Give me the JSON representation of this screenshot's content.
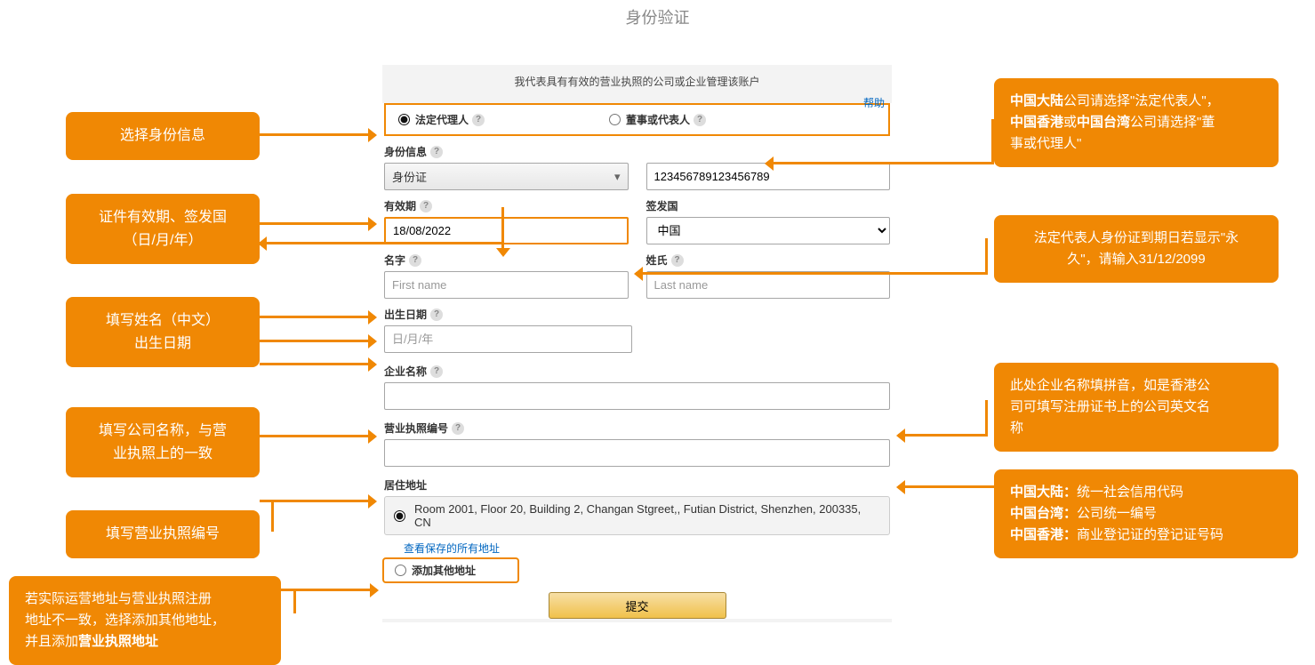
{
  "page": {
    "title": "身份验证"
  },
  "form": {
    "subtitle": "我代表具有有效的营业执照的公司或企业管理该账户",
    "help_link": "帮助",
    "person_type": {
      "opt1": "法定代理人",
      "opt2": "董事或代表人"
    },
    "identity": {
      "label": "身份信息",
      "doc_type": "身份证",
      "id_number": "123456789123456789"
    },
    "expiry": {
      "label": "有效期",
      "value": "18/08/2022"
    },
    "issue_country": {
      "label": "签发国",
      "value": "中国"
    },
    "first_name": {
      "label": "名字",
      "placeholder": "First name"
    },
    "last_name": {
      "label": "姓氏",
      "placeholder": "Last name"
    },
    "dob": {
      "label": "出生日期",
      "placeholder": "日/月/年"
    },
    "company": {
      "label": "企业名称"
    },
    "license_no": {
      "label": "营业执照编号"
    },
    "address": {
      "label": "居住地址",
      "saved": "Room 2001, Floor 20, Building 2, Changan Stgreet,, Futian District, Shenzhen, 200335, CN",
      "view_all": "查看保存的所有地址",
      "add_new": "添加其他地址"
    },
    "submit": "提交"
  },
  "callouts": {
    "l1": "选择身份信息",
    "l2_a": "证件有效期、签发国",
    "l2_b": "（日/月/年）",
    "l3_a": "填写姓名（中文）",
    "l3_b": "出生日期",
    "l4_a": "填写公司名称，与营",
    "l4_b": "业执照上的一致",
    "l5": "填写营业执照编号",
    "l6_a": "若实际运营地址与营业执照注册",
    "l6_b": "地址不一致，选择添加其他地址，",
    "l6_c": "并且添加",
    "l6_c_bold": "营业执照地址",
    "r1_pre": "中国大陆",
    "r1_a": "公司请选择\"法定代表人\"，",
    "r1_pre2": "中国香港",
    "r1_mid": "或",
    "r1_pre3": "中国台湾",
    "r1_b": "公司请选择\"董",
    "r1_c": "事或代理人\"",
    "r2_a": "法定代表人身份证到期日若显示\"永",
    "r2_b": "久\"，请输入31/12/2099",
    "r3_a": "此处企业名称填拼音，如是香港公",
    "r3_b": "司可填写注册证书上的公司英文名",
    "r3_c": "称",
    "r4_l1_b": "中国大陆：",
    "r4_l1": "统一社会信用代码",
    "r4_l2_b": "中国台湾：",
    "r4_l2": "公司统一编号",
    "r4_l3_b": "中国香港：",
    "r4_l3": "商业登记证的登记证号码"
  }
}
